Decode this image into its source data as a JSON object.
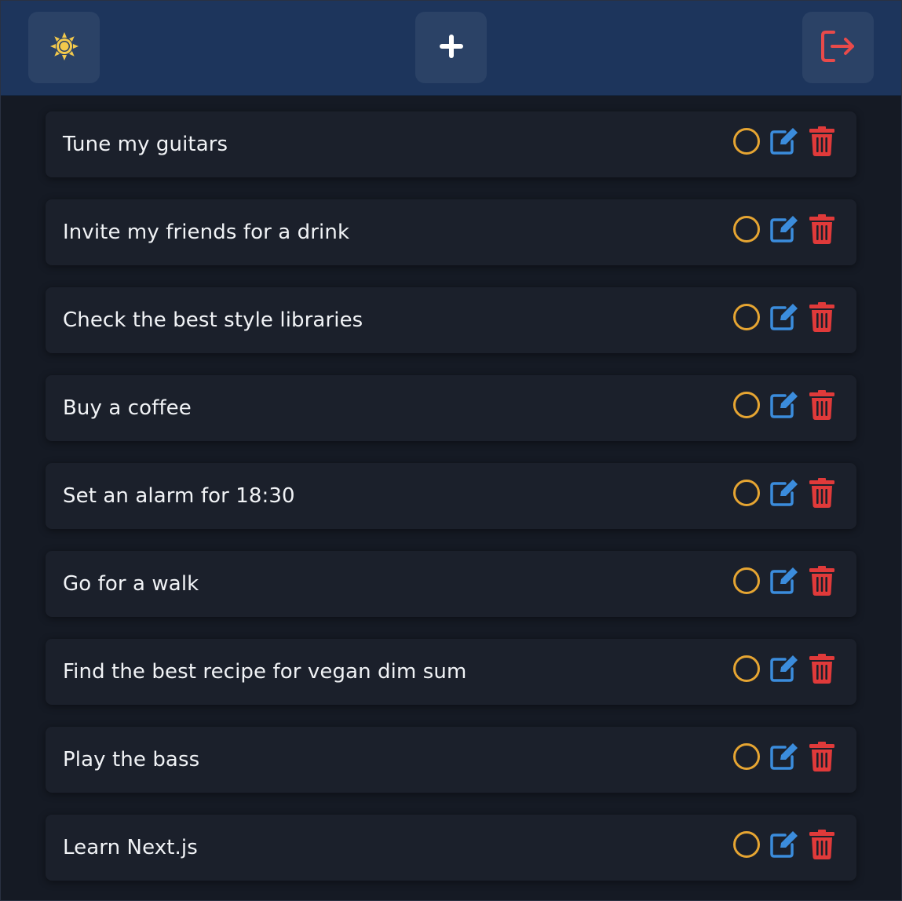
{
  "header": {
    "theme_icon": "sun-icon",
    "add_icon": "plus-icon",
    "logout_icon": "logout-icon"
  },
  "colors": {
    "header_bg": "#1d355c",
    "check": "#e6a532",
    "edit": "#3b8cdc",
    "delete": "#e03a3a",
    "sun": "#f2c94c",
    "logout": "#e84a4a"
  },
  "todos": [
    {
      "text": "Tune my guitars"
    },
    {
      "text": "Invite my friends for a drink"
    },
    {
      "text": "Check the best style libraries"
    },
    {
      "text": "Buy a coffee"
    },
    {
      "text": "Set an alarm for 18:30"
    },
    {
      "text": "Go for a walk"
    },
    {
      "text": "Find the best recipe for vegan dim sum"
    },
    {
      "text": "Play the bass"
    },
    {
      "text": "Learn Next.js"
    }
  ],
  "row_icons": {
    "complete": "circle-check-icon",
    "edit": "edit-icon",
    "delete": "trash-icon"
  }
}
